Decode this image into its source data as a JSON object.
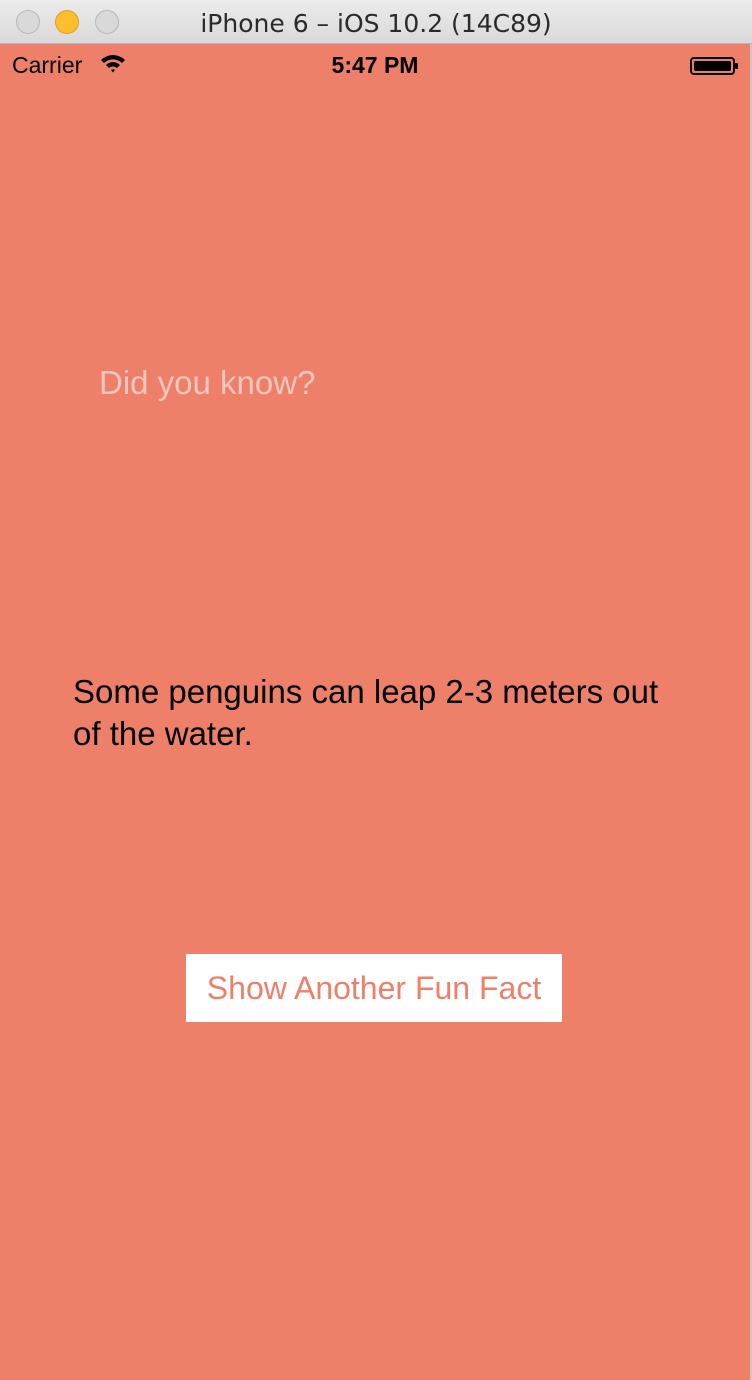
{
  "window": {
    "title": "iPhone 6 – iOS 10.2 (14C89)"
  },
  "status_bar": {
    "carrier": "Carrier",
    "time": "5:47 PM",
    "wifi_icon": "wifi-icon",
    "battery_icon": "battery-icon"
  },
  "main": {
    "heading": "Did you know?",
    "fact": "Some penguins can leap 2-3 meters out of the water.",
    "button_label": "Show Another Fun Fact"
  },
  "colors": {
    "background": "#ee806a",
    "button_background": "#ffffff",
    "button_text": "#ee806a",
    "minimize_button": "#fdbe2e"
  }
}
